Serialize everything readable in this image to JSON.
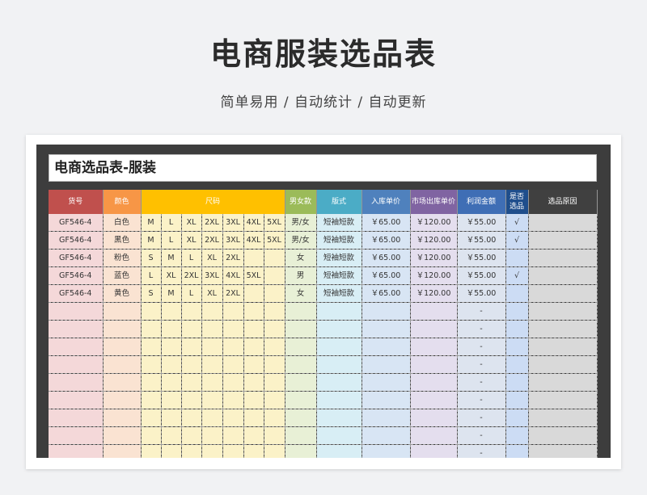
{
  "page": {
    "title": "电商服装选品表",
    "subtitle": "简单易用 / 自动统计 / 自动更新"
  },
  "sheet": {
    "title": "电商选品表-服装",
    "headers": {
      "id": "货号",
      "color": "颜色",
      "size": "尺码",
      "gender": "男女款",
      "style": "版式",
      "cost": "入库单价",
      "market": "市场出库单价",
      "profit": "利润金额",
      "picked": "是否选品",
      "reason": "选品原因"
    },
    "header_colors": {
      "id": "#c0504d",
      "color": "#f79646",
      "size": "#ffc000",
      "gender": "#9bbb59",
      "style": "#4bacc6",
      "cost": "#4f81bd",
      "market": "#8064a2",
      "profit": "#3f6eb5",
      "picked": "#1f4e8c",
      "reason": "#404040"
    },
    "rows": [
      {
        "id": "GF546-4",
        "color": "白色",
        "sizes": [
          "M",
          "L",
          "XL",
          "2XL",
          "3XL",
          "4XL",
          "5XL"
        ],
        "gender": "男/女",
        "style": "短袖短款",
        "cost": "￥65.00",
        "market": "￥120.00",
        "profit": "￥55.00",
        "picked": "√",
        "reason": ""
      },
      {
        "id": "GF546-4",
        "color": "黑色",
        "sizes": [
          "M",
          "L",
          "XL",
          "2XL",
          "3XL",
          "4XL",
          "5XL"
        ],
        "gender": "男/女",
        "style": "短袖短款",
        "cost": "￥65.00",
        "market": "￥120.00",
        "profit": "￥55.00",
        "picked": "√",
        "reason": ""
      },
      {
        "id": "GF546-4",
        "color": "粉色",
        "sizes": [
          "S",
          "M",
          "L",
          "XL",
          "2XL",
          "",
          ""
        ],
        "gender": "女",
        "style": "短袖短款",
        "cost": "￥65.00",
        "market": "￥120.00",
        "profit": "￥55.00",
        "picked": "",
        "reason": ""
      },
      {
        "id": "GF546-4",
        "color": "蓝色",
        "sizes": [
          "L",
          "XL",
          "2XL",
          "3XL",
          "4XL",
          "5XL",
          ""
        ],
        "gender": "男",
        "style": "短袖短款",
        "cost": "￥65.00",
        "market": "￥120.00",
        "profit": "￥55.00",
        "picked": "√",
        "reason": ""
      },
      {
        "id": "GF546-4",
        "color": "黄色",
        "sizes": [
          "S",
          "M",
          "L",
          "XL",
          "2XL",
          "",
          ""
        ],
        "gender": "女",
        "style": "短袖短款",
        "cost": "￥65.00",
        "market": "￥120.00",
        "profit": "￥55.00",
        "picked": "",
        "reason": ""
      }
    ],
    "empty_row_profit": "-",
    "empty_row_count": 10
  }
}
